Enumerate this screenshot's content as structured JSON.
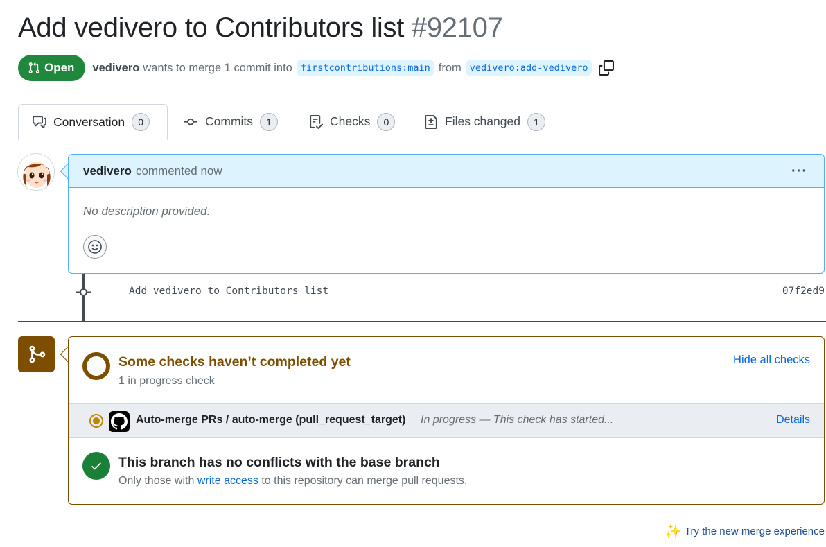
{
  "header": {
    "title": "Add vedivero to Contributors list",
    "number": "#92107"
  },
  "meta": {
    "state": "Open",
    "author": "vedivero",
    "merge_text": "wants to merge 1 commit into",
    "base_branch": "firstcontributions:main",
    "from_text": "from",
    "head_branch": "vedivero:add-vedivero"
  },
  "tabs": [
    {
      "label": "Conversation",
      "count": "0",
      "icon": "comment-discussion-icon"
    },
    {
      "label": "Commits",
      "count": "1",
      "icon": "git-commit-icon"
    },
    {
      "label": "Checks",
      "count": "0",
      "icon": "checklist-icon"
    },
    {
      "label": "Files changed",
      "count": "1",
      "icon": "file-diff-icon"
    }
  ],
  "comment": {
    "author": "vedivero",
    "action": "commented now",
    "body": "No description provided.",
    "menu": "···"
  },
  "commit": {
    "message": "Add vedivero to Contributors list",
    "sha": "07f2ed9"
  },
  "merge": {
    "checks_title": "Some checks haven’t completed yet",
    "checks_subtitle": "1 in progress check",
    "hide_checks": "Hide all checks",
    "check": {
      "name": "Auto-merge PRs / auto-merge (pull_request_target)",
      "status": "In progress — This check has started...",
      "details": "Details"
    },
    "conflict_title": "This branch has no conflicts with the base branch",
    "conflict_sub_pre": "Only those with",
    "conflict_link": "write access",
    "conflict_sub_post": "to this repository can merge pull requests."
  },
  "footer": {
    "try_new": "Try the new merge experience"
  },
  "colors": {
    "open_green": "#1f883d",
    "link_blue": "#0969da",
    "pending_brown": "#7d4e00",
    "success_green": "#1a7f37",
    "comment_header_bg": "#ddf4ff"
  }
}
